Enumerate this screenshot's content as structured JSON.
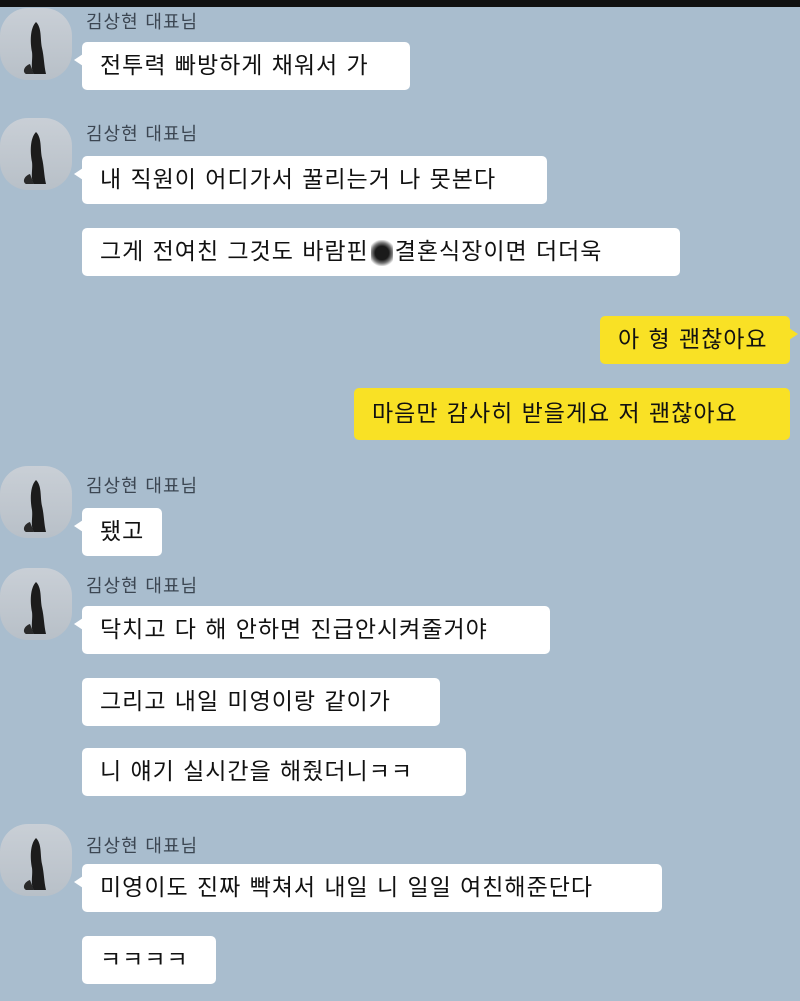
{
  "messages": [
    {
      "sender": "김상현 대표님",
      "bubbles": [
        "전투력 빠방하게 채워서 가"
      ]
    },
    {
      "sender": "김상현 대표님",
      "bubbles": [
        "내 직원이 어디가서 꿀리는거 나 못본다",
        "그게 전여친 그것도 바람핀",
        "결혼식장이면 더더욱"
      ]
    },
    {
      "mine": true,
      "bubbles": [
        "아 형 괜찮아요",
        "마음만 감사히 받을게요 저 괜찮아요"
      ]
    },
    {
      "sender": "김상현 대표님",
      "bubbles": [
        "됐고"
      ]
    },
    {
      "sender": "김상현 대표님",
      "bubbles": [
        "닥치고 다 해 안하면 진급안시켜줄거야",
        "그리고 내일 미영이랑 같이가",
        "니 얘기 실시간을 해줬더니ㅋㅋ"
      ]
    },
    {
      "sender": "김상현 대표님",
      "bubbles": [
        "미영이도 진짜 빡쳐서 내일 니 일일 여친해준단다",
        "ㅋㅋㅋㅋ"
      ]
    }
  ],
  "colors": {
    "background": "#a9bdce",
    "incoming_bubble": "#ffffff",
    "outgoing_bubble": "#f9e125"
  },
  "icons": {
    "avatar": "profile-photo-icon",
    "redaction": "blurred-blot"
  }
}
